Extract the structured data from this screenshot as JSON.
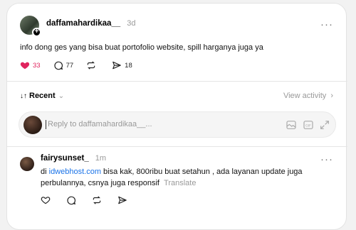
{
  "post": {
    "author": "daffamahardikaa__",
    "time": "3d",
    "more": "···",
    "text": "info dong ges yang bisa buat portofolio website, spill harganya juga ya",
    "likes": "33",
    "comments": "77",
    "shares": "18",
    "follow_badge": "+"
  },
  "thread": {
    "sort_icon": "↓↑",
    "sort_label": "Recent",
    "sort_chevron": "⌄",
    "view_activity": "View activity",
    "view_activity_chevron": "›"
  },
  "reply_box": {
    "placeholder": "Reply to daffamahardikaa__..."
  },
  "reply": {
    "author": "fairysunset_",
    "time": "1m",
    "more": "···",
    "link_text": "idwebhost.com",
    "text_before": "di ",
    "text_after": " bisa kak, 800ribu buat setahun , ada layanan update juga perbulannya, csnya juga responsif",
    "translate": "Translate"
  },
  "colors": {
    "like": "#e0245e",
    "link": "#1a73e8",
    "muted": "#999999"
  }
}
